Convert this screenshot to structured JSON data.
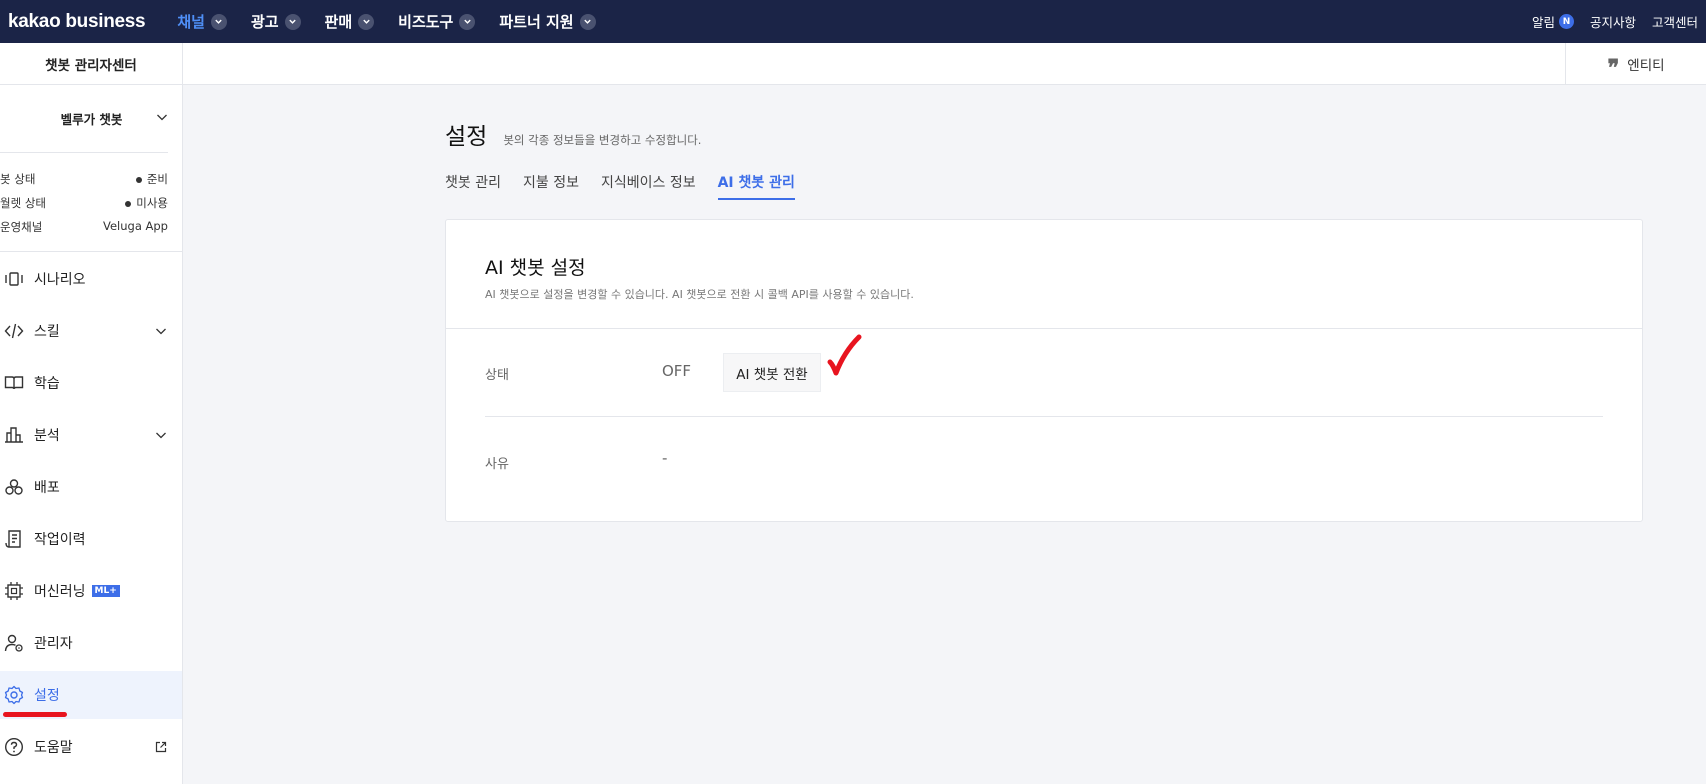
{
  "header": {
    "brand": "kakao business",
    "nav": [
      {
        "label": "채널",
        "active": true
      },
      {
        "label": "광고",
        "active": false
      },
      {
        "label": "판매",
        "active": false
      },
      {
        "label": "비즈도구",
        "active": false
      },
      {
        "label": "파트너 지원",
        "active": false
      }
    ],
    "util": {
      "alerts": "알림",
      "alerts_badge": "N",
      "notices": "공지사항",
      "support": "고객센터"
    }
  },
  "subheader": {
    "center_title": "챗봇 관리자센터",
    "entity": "엔티티"
  },
  "sidebar": {
    "bot_name": "벨루가 챗봇",
    "status": [
      {
        "label": "봇 상태",
        "value": "준비",
        "dot": true
      },
      {
        "label": "월렛 상태",
        "value": "미사용",
        "dot": true
      },
      {
        "label": "운영채널",
        "value": "Veluga App",
        "dot": false
      }
    ],
    "menu": [
      {
        "label": "시나리오",
        "icon": "scenario-icon"
      },
      {
        "label": "스킬",
        "icon": "code-icon",
        "chevron": true
      },
      {
        "label": "학습",
        "icon": "book-icon"
      },
      {
        "label": "분석",
        "icon": "chart-icon",
        "chevron": true
      },
      {
        "label": "배포",
        "icon": "deploy-icon"
      },
      {
        "label": "작업이력",
        "icon": "history-icon"
      },
      {
        "label": "머신러닝",
        "icon": "chip-icon",
        "badge": "ML+"
      },
      {
        "label": "관리자",
        "icon": "admin-icon"
      },
      {
        "label": "설정",
        "icon": "gear-icon",
        "active": true
      },
      {
        "label": "도움말",
        "icon": "help-icon",
        "external": true
      }
    ]
  },
  "main": {
    "title": "설정",
    "description": "봇의 각종 정보들을 변경하고 수정합니다.",
    "tabs": [
      {
        "label": "챗봇 관리",
        "active": false
      },
      {
        "label": "지불 정보",
        "active": false
      },
      {
        "label": "지식베이스 정보",
        "active": false
      },
      {
        "label": "AI 챗봇 관리",
        "active": true
      }
    ],
    "card": {
      "title": "AI 챗봇 설정",
      "description": "AI 챗봇으로 설정을 변경할 수 있습니다. AI 챗봇으로 전환 시 콜백 API를 사용할 수 있습니다.",
      "status_label": "상태",
      "status_value": "OFF",
      "switch_button": "AI 챗봇 전환",
      "reason_label": "사유",
      "reason_value": "-"
    }
  },
  "colors": {
    "nav_bg": "#1b2447",
    "accent": "#3d6ee8",
    "annotation_red": "#e8141f"
  }
}
